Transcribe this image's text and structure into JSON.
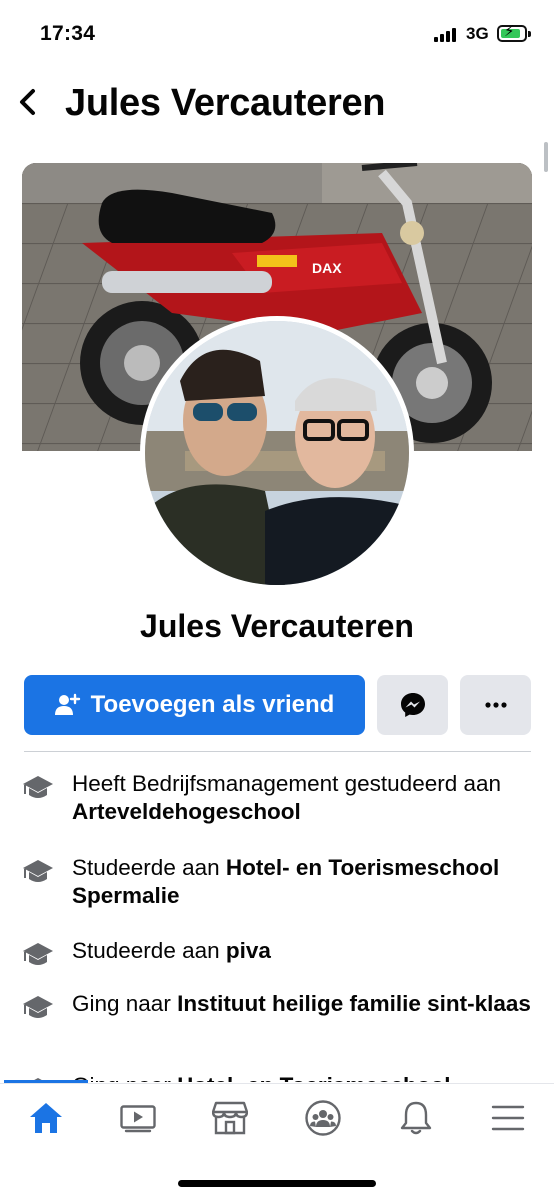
{
  "status_bar": {
    "time": "17:34",
    "network": "3G",
    "icons": [
      "signal-icon",
      "battery-charging-icon"
    ]
  },
  "header": {
    "title": "Jules Vercauteren",
    "back_icon": "chevron-left-icon"
  },
  "profile": {
    "name": "Jules Vercauteren",
    "cover_photo": "red-honda-dax-motorcycle",
    "avatar_photo": "two-men-selfie"
  },
  "actions": {
    "add_friend_label": "Toevoegen als vriend",
    "add_friend_icon": "person-add-icon",
    "messenger_icon": "messenger-icon",
    "more_icon": "more-dots-icon"
  },
  "details": [
    {
      "icon": "graduation-cap-icon",
      "prefix": "Heeft Bedrijfsmanagement gestudeerd aan ",
      "bold": "Arteveldehogeschool"
    },
    {
      "icon": "graduation-cap-icon",
      "prefix": "Studeerde aan ",
      "bold": "Hotel- en Toerismeschool Spermalie"
    },
    {
      "icon": "graduation-cap-icon",
      "prefix": "Studeerde aan ",
      "bold": "piva"
    },
    {
      "icon": "graduation-cap-icon",
      "prefix": "Ging naar ",
      "bold": "Instituut heilige familie sint-klaas"
    },
    {
      "icon": "graduation-cap-icon",
      "prefix": "Ging naar ",
      "bold": "Hotel- en Toerismeschool"
    }
  ],
  "bottom_nav": {
    "items": [
      "home-icon",
      "video-icon",
      "marketplace-icon",
      "groups-icon",
      "notifications-icon",
      "menu-icon"
    ],
    "active": "home-icon",
    "accent_color": "#1b74e4"
  }
}
